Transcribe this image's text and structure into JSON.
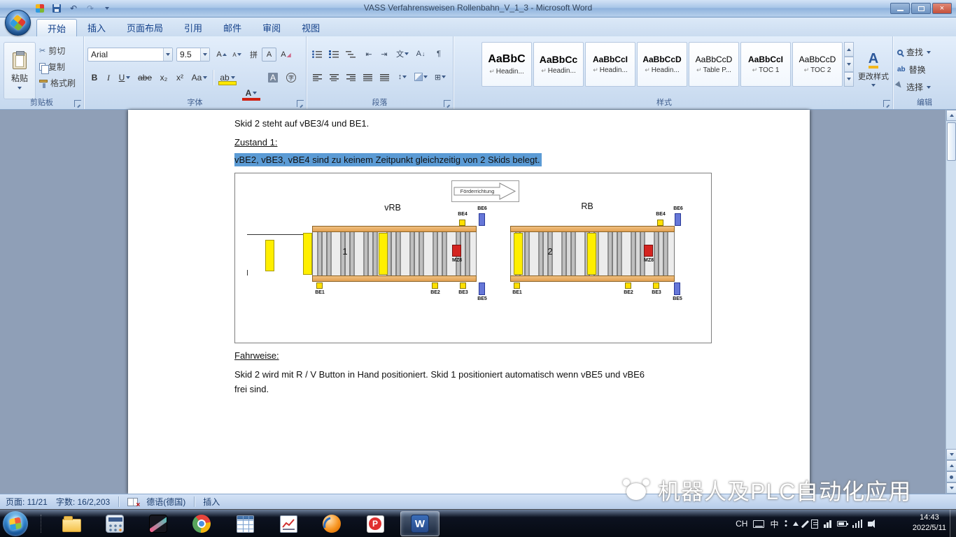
{
  "window": {
    "title": "VASS Verfahrensweisen Rollenbahn_V_1_3 - Microsoft Word"
  },
  "icons": {
    "style_mark": "↵",
    "undo": "↶",
    "redo": "↷",
    "cut": "✂",
    "bold": "B",
    "italic": "I",
    "underline": "U",
    "strike": "abe",
    "subscript": "x₂",
    "superscript": "x²",
    "case": "Aa",
    "highlight": "ab",
    "font_color": "A",
    "char_shading": "A",
    "enclose": "字",
    "grow_font": "A",
    "shrink_font": "A",
    "pinyin": "拼",
    "char_border": "A",
    "clear_format": "A",
    "sort_a": "A",
    "sort_arrow": "↓",
    "pilcrow": "¶",
    "spacing_arrows": "↕",
    "borders_grid": "⊞",
    "outdent": "⇤",
    "indent": "⇥",
    "asian_layout": "文",
    "replace_ab": "ab",
    "change_styles_a": "A",
    "word_w": "W",
    "p_app": "P"
  },
  "tabs": {
    "items": [
      {
        "label": "开始"
      },
      {
        "label": "插入"
      },
      {
        "label": "页面布局"
      },
      {
        "label": "引用"
      },
      {
        "label": "邮件"
      },
      {
        "label": "审阅"
      },
      {
        "label": "视图"
      }
    ]
  },
  "ribbon": {
    "clipboard": {
      "group_label": "剪贴板",
      "paste": "粘贴",
      "cut": "剪切",
      "copy": "复制",
      "format_painter": "格式刷"
    },
    "font": {
      "group_label": "字体",
      "font_name": "Arial",
      "font_size": "9.5"
    },
    "paragraph": {
      "group_label": "段落"
    },
    "styles": {
      "group_label": "样式",
      "change_styles": "更改样式",
      "items": [
        {
          "preview": "AaBbC",
          "name": "Headin..."
        },
        {
          "preview": "AaBbCc",
          "name": "Headin..."
        },
        {
          "preview": "AaBbCcI",
          "name": "Headin..."
        },
        {
          "preview": "AaBbCcD",
          "name": "Headin..."
        },
        {
          "preview": "AaBbCcD",
          "name": "Table P..."
        },
        {
          "preview": "AaBbCcI",
          "name": "TOC 1"
        },
        {
          "preview": "AaBbCcD",
          "name": "TOC 2"
        }
      ]
    },
    "editing": {
      "group_label": "编辑",
      "find": "查找",
      "replace": "替换",
      "select": "选择"
    }
  },
  "document": {
    "line1": "Skid 2 steht  auf vBE3/4 und BE1.",
    "line2": "Zustand 1:",
    "highlighted": "vBE2, vBE3, vBE4 sind zu keinem Zeitpunkt  gleichzeitig  von 2 Skids belegt.",
    "fahrweise": "Fahrweise:",
    "para_line1": "Skid 2 wird mit R / V Button in Hand positioniert.  Skid 1 positioniert  automatisch  wenn  vBE5 und  vBE6",
    "para_line2": "frei sind.",
    "diagram": {
      "direction": "Förderrichtung",
      "left_label": "vRB",
      "right_label": "RB",
      "skid1": "1",
      "skid2": "2",
      "mz8_left": "MZ8",
      "mz8_right": "MZ8",
      "left_top_sensors": [
        {
          "label": "BE4"
        },
        {
          "label": "BE6"
        }
      ],
      "left_bottom_sensors": [
        {
          "label": "BE1"
        },
        {
          "label": "BE2"
        },
        {
          "label": "BE3"
        },
        {
          "label": "BE5"
        }
      ],
      "right_top_sensors": [
        {
          "label": "BE4"
        },
        {
          "label": "BE6"
        }
      ],
      "right_bottom_sensors": [
        {
          "label": "BE1"
        },
        {
          "label": "BE2"
        },
        {
          "label": "BE3"
        },
        {
          "label": "BE5"
        }
      ]
    }
  },
  "status_bar": {
    "page": "页面: 11/21",
    "words": "字数: 16/2,203",
    "language": "德语(德国)",
    "insert_mode": "插入"
  },
  "watermark": {
    "text": "机器人及PLC自动化应用"
  },
  "taskbar": {
    "tray_lang": "CH",
    "tray_cn": "中",
    "time": "14:43",
    "date": "2022/5/11"
  }
}
